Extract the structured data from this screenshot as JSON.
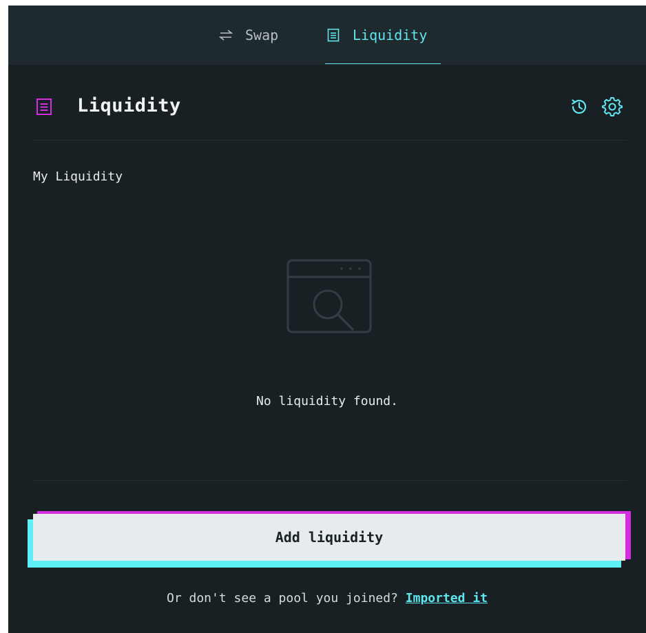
{
  "tabs": {
    "swap": {
      "label": "Swap",
      "icon": "swap-arrows-icon"
    },
    "liquidity": {
      "label": "Liquidity",
      "icon": "liquidity-icon",
      "active": true
    }
  },
  "header": {
    "title": "Liquidity",
    "icon": "liquidity-icon",
    "actions": [
      {
        "name": "history",
        "icon": "history-icon"
      },
      {
        "name": "settings",
        "icon": "gear-icon"
      }
    ]
  },
  "section": {
    "label": "My Liquidity"
  },
  "empty_state": {
    "icon": "empty-search-window-icon",
    "message": "No liquidity found."
  },
  "actions": {
    "add_liquidity_label": "Add liquidity"
  },
  "footer": {
    "prompt": "Or don't see a pool you joined?",
    "link_label": "Imported it"
  },
  "colors": {
    "background": "#192023",
    "tabbar": "#1f2a2f",
    "accent_cyan": "#5fe6ee",
    "accent_magenta": "#d42ee0",
    "button_face": "#e6ebee",
    "text": "#e8eced"
  }
}
